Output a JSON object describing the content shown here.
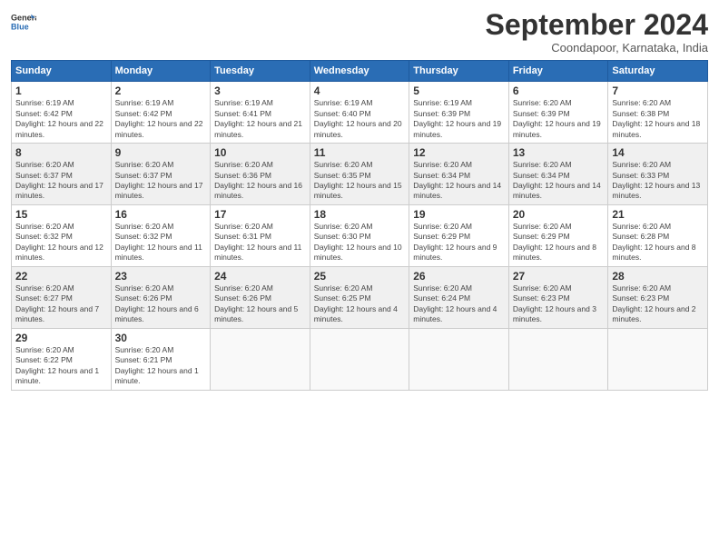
{
  "header": {
    "logo_line1": "General",
    "logo_line2": "Blue",
    "month_title": "September 2024",
    "subtitle": "Coondapoor, Karnataka, India"
  },
  "weekdays": [
    "Sunday",
    "Monday",
    "Tuesday",
    "Wednesday",
    "Thursday",
    "Friday",
    "Saturday"
  ],
  "days": [
    {
      "date": "1",
      "col": 0,
      "sunrise": "6:19 AM",
      "sunset": "6:42 PM",
      "daylight": "12 hours and 22 minutes."
    },
    {
      "date": "2",
      "col": 1,
      "sunrise": "6:19 AM",
      "sunset": "6:42 PM",
      "daylight": "12 hours and 22 minutes."
    },
    {
      "date": "3",
      "col": 2,
      "sunrise": "6:19 AM",
      "sunset": "6:41 PM",
      "daylight": "12 hours and 21 minutes."
    },
    {
      "date": "4",
      "col": 3,
      "sunrise": "6:19 AM",
      "sunset": "6:40 PM",
      "daylight": "12 hours and 20 minutes."
    },
    {
      "date": "5",
      "col": 4,
      "sunrise": "6:19 AM",
      "sunset": "6:39 PM",
      "daylight": "12 hours and 19 minutes."
    },
    {
      "date": "6",
      "col": 5,
      "sunrise": "6:20 AM",
      "sunset": "6:39 PM",
      "daylight": "12 hours and 19 minutes."
    },
    {
      "date": "7",
      "col": 6,
      "sunrise": "6:20 AM",
      "sunset": "6:38 PM",
      "daylight": "12 hours and 18 minutes."
    },
    {
      "date": "8",
      "col": 0,
      "sunrise": "6:20 AM",
      "sunset": "6:37 PM",
      "daylight": "12 hours and 17 minutes."
    },
    {
      "date": "9",
      "col": 1,
      "sunrise": "6:20 AM",
      "sunset": "6:37 PM",
      "daylight": "12 hours and 17 minutes."
    },
    {
      "date": "10",
      "col": 2,
      "sunrise": "6:20 AM",
      "sunset": "6:36 PM",
      "daylight": "12 hours and 16 minutes."
    },
    {
      "date": "11",
      "col": 3,
      "sunrise": "6:20 AM",
      "sunset": "6:35 PM",
      "daylight": "12 hours and 15 minutes."
    },
    {
      "date": "12",
      "col": 4,
      "sunrise": "6:20 AM",
      "sunset": "6:34 PM",
      "daylight": "12 hours and 14 minutes."
    },
    {
      "date": "13",
      "col": 5,
      "sunrise": "6:20 AM",
      "sunset": "6:34 PM",
      "daylight": "12 hours and 14 minutes."
    },
    {
      "date": "14",
      "col": 6,
      "sunrise": "6:20 AM",
      "sunset": "6:33 PM",
      "daylight": "12 hours and 13 minutes."
    },
    {
      "date": "15",
      "col": 0,
      "sunrise": "6:20 AM",
      "sunset": "6:32 PM",
      "daylight": "12 hours and 12 minutes."
    },
    {
      "date": "16",
      "col": 1,
      "sunrise": "6:20 AM",
      "sunset": "6:32 PM",
      "daylight": "12 hours and 11 minutes."
    },
    {
      "date": "17",
      "col": 2,
      "sunrise": "6:20 AM",
      "sunset": "6:31 PM",
      "daylight": "12 hours and 11 minutes."
    },
    {
      "date": "18",
      "col": 3,
      "sunrise": "6:20 AM",
      "sunset": "6:30 PM",
      "daylight": "12 hours and 10 minutes."
    },
    {
      "date": "19",
      "col": 4,
      "sunrise": "6:20 AM",
      "sunset": "6:29 PM",
      "daylight": "12 hours and 9 minutes."
    },
    {
      "date": "20",
      "col": 5,
      "sunrise": "6:20 AM",
      "sunset": "6:29 PM",
      "daylight": "12 hours and 8 minutes."
    },
    {
      "date": "21",
      "col": 6,
      "sunrise": "6:20 AM",
      "sunset": "6:28 PM",
      "daylight": "12 hours and 8 minutes."
    },
    {
      "date": "22",
      "col": 0,
      "sunrise": "6:20 AM",
      "sunset": "6:27 PM",
      "daylight": "12 hours and 7 minutes."
    },
    {
      "date": "23",
      "col": 1,
      "sunrise": "6:20 AM",
      "sunset": "6:26 PM",
      "daylight": "12 hours and 6 minutes."
    },
    {
      "date": "24",
      "col": 2,
      "sunrise": "6:20 AM",
      "sunset": "6:26 PM",
      "daylight": "12 hours and 5 minutes."
    },
    {
      "date": "25",
      "col": 3,
      "sunrise": "6:20 AM",
      "sunset": "6:25 PM",
      "daylight": "12 hours and 4 minutes."
    },
    {
      "date": "26",
      "col": 4,
      "sunrise": "6:20 AM",
      "sunset": "6:24 PM",
      "daylight": "12 hours and 4 minutes."
    },
    {
      "date": "27",
      "col": 5,
      "sunrise": "6:20 AM",
      "sunset": "6:23 PM",
      "daylight": "12 hours and 3 minutes."
    },
    {
      "date": "28",
      "col": 6,
      "sunrise": "6:20 AM",
      "sunset": "6:23 PM",
      "daylight": "12 hours and 2 minutes."
    },
    {
      "date": "29",
      "col": 0,
      "sunrise": "6:20 AM",
      "sunset": "6:22 PM",
      "daylight": "12 hours and 1 minute."
    },
    {
      "date": "30",
      "col": 1,
      "sunrise": "6:20 AM",
      "sunset": "6:21 PM",
      "daylight": "12 hours and 1 minute."
    }
  ]
}
